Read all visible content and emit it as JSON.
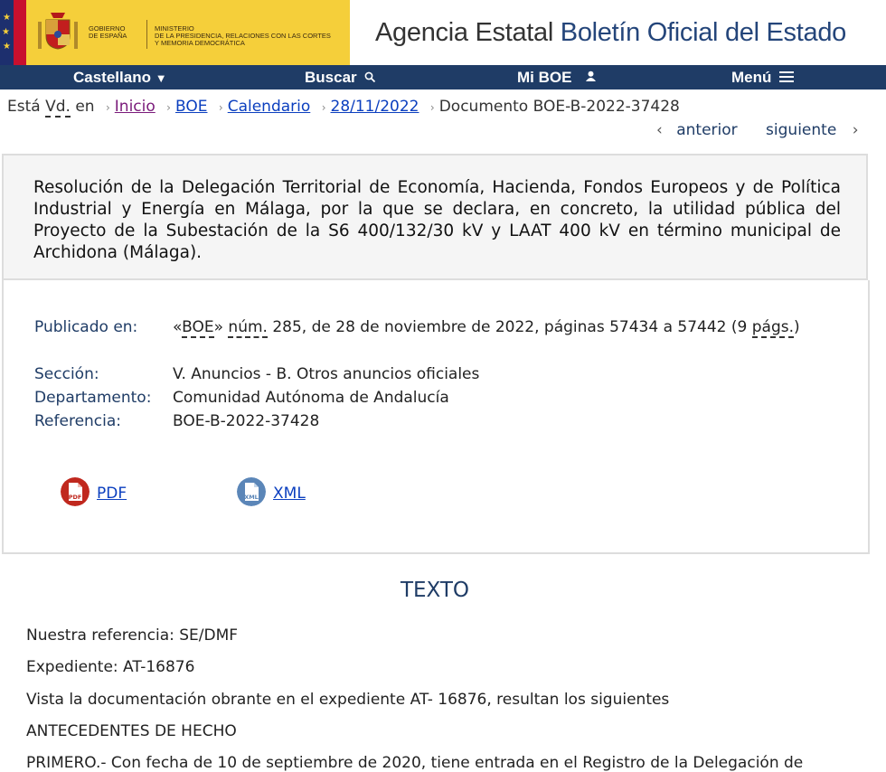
{
  "header": {
    "gov_line1": "Gobierno",
    "gov_line2": "de España",
    "ministry_line1": "Ministerio",
    "ministry_line2": "de la Presidencia, Relaciones con las Cortes",
    "ministry_line3": "y Memoria Democrática",
    "agency_prefix": "Agencia Estatal",
    "agency_name": "Boletín Oficial del Estado"
  },
  "nav": {
    "language": "Castellano",
    "search": "Buscar",
    "my_boe": "Mi BOE",
    "menu": "Menú"
  },
  "breadcrumb": {
    "prefix_esta": "Está",
    "prefix_vd": "Vd.",
    "prefix_en": "en",
    "items": [
      "Inicio",
      "BOE",
      "Calendario",
      "28/11/2022"
    ],
    "current": "Documento BOE-B-2022-37428"
  },
  "pager": {
    "previous": "anterior",
    "next": "siguiente"
  },
  "document": {
    "title": "Resolución de la Delegación Territorial de Economía, Hacienda, Fondos Europeos y de Política Industrial y Energía en Málaga, por la que se declara, en concreto, la utilidad pública del Proyecto de la Subestación de la S6 400/132/30 kV y LAAT 400 kV en término municipal de Archidona (Málaga).",
    "meta": {
      "published_label": "Publicado en:",
      "published_open": "«",
      "published_boe": "BOE",
      "published_close": "»",
      "published_num": "núm.",
      "published_rest": " 285, de 28 de noviembre de 2022, páginas 57434 a 57442 (9",
      "published_pags": "págs.",
      "published_end": ")",
      "section_label": "Sección:",
      "section_value": "V. Anuncios - B. Otros anuncios oficiales",
      "department_label": "Departamento:",
      "department_value": "Comunidad Autónoma de Andalucía",
      "reference_label": "Referencia:",
      "reference_value": "BOE-B-2022-37428"
    },
    "downloads": {
      "pdf": "PDF",
      "xml": "XML",
      "pdf_badge": "PDF",
      "xml_badge": "XML"
    }
  },
  "texto": {
    "heading": "TEXTO",
    "paragraphs": [
      "Nuestra referencia: SE/DMF",
      "Expediente: AT-16876",
      "Vista la documentación obrante en el expediente AT- 16876, resultan los siguientes",
      "ANTECEDENTES DE HECHO",
      "PRIMERO.- Con fecha de 10 de septiembre de 2020, tiene entrada en el Registro de la Delegación de"
    ]
  },
  "colors": {
    "nav_bg": "#1f3c66",
    "gov_yellow": "#f5cf3a",
    "link": "#0b3fbf"
  }
}
